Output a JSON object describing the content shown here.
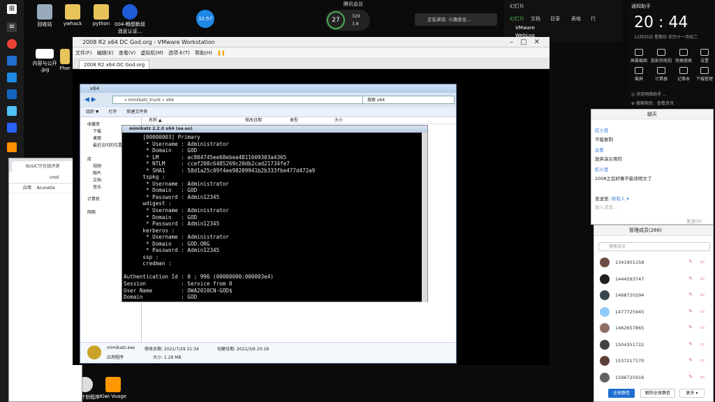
{
  "desktop": {
    "icons": [
      {
        "label": "回收站"
      },
      {
        "label": "ywhack"
      },
      {
        "label": "python"
      },
      {
        "label": "004-畅想新叔 消息认证..."
      },
      {
        "label": "内容与公开 .jpg"
      },
      {
        "label": "Fhor"
      }
    ],
    "bottom_icons": [
      {
        "label": "任务计划程序"
      },
      {
        "label": "Kiwi Vuage"
      }
    ]
  },
  "timer": "32:57",
  "network": {
    "percent": "27",
    "up": "329",
    "down": "3.8"
  },
  "livebar": {
    "label": "腾讯会议"
  },
  "screen_share": {
    "label": "正在讲话: 小逸安全..."
  },
  "ppt": {
    "title": "幻灯片",
    "tabs": [
      "幻灯片",
      "文档",
      "目录",
      "表格",
      "行"
    ],
    "items": [
      "VMware",
      "WebLog"
    ]
  },
  "notification": {
    "header": "通知助手",
    "time": "20 : 44",
    "date": "12月05日 星期日 农历十一月初二",
    "actions": [
      "屏幕截图",
      "投影到电视",
      "快捷搜索",
      "设置",
      "截屏",
      "计算器",
      "记事本",
      "下载管理"
    ],
    "footer": "◎ 浏览网络助手 ...",
    "link": "⊕ 搜索网页，查看资讯"
  },
  "vmware": {
    "title": "2008 R2 x64 DC God.org - VMware Workstation",
    "menu": [
      "文件(F)",
      "编辑(E)",
      "查看(V)",
      "虚拟机(M)",
      "选项卡(T)",
      "帮助(H)"
    ],
    "tab": "2008 R2 x64 DC God.org"
  },
  "explorer": {
    "title": "x64",
    "address": "« mimikatz_trunk » x64",
    "search": "搜索 x64",
    "toolbar": [
      "组织 ▼",
      "打开",
      "新建文件夹"
    ],
    "columns": [
      "名称 ▲",
      "修改日期",
      "类型",
      "大小"
    ],
    "nav": [
      "收藏夹",
      "下载",
      "桌面",
      "最近访问的位置",
      "库",
      "视频",
      "图片",
      "文档",
      "音乐",
      "计算机",
      "网络"
    ],
    "details": {
      "file": "mimikatz.exe",
      "modified": "修改日期: 2021/7/29 21:34",
      "created": "创建日期: 2021/3/9 20:18",
      "type": "应用程序",
      "size": "大小: 1.29 MB"
    }
  },
  "terminal": {
    "title": "mimikatz 2.2.0 x64 (oe.eo)",
    "lines": [
      "      [00000003] Primary",
      "       * Username : Administrator",
      "       * Domain   : GOD",
      "       * LM       : ac804745ee68ebea4811609303a4365",
      "       * NTLM     : ccef208c6485269c20db2cad21734fe7",
      "       * SHA1     : 58d1a25c09f4ee98209941b2b333fbe477d472a9",
      "      tspkg :",
      "       * Username : Administrator",
      "       * Domain   : GOD",
      "       * Password : Admin12345",
      "      wdigest :",
      "       * Username : Administrator",
      "       * Domain   : GOD",
      "       * Password : Admin12345",
      "      kerberos :",
      "       * Username : Administrator",
      "       * Domain   : GOD.ORG",
      "       * Password : Admin12345",
      "      ssp :",
      "      credman :",
      "",
      "Authentication Id : 0 ; 996 (00000000:000003e4)",
      "Session           : Service from 0",
      "User Name         : OWA2010CN-GOD$",
      "Domain            : GOD"
    ]
  },
  "chrome": {
    "tab": "BUUCTF在线评测",
    "url": "cmd",
    "bookmarks": [
      "应用",
      "Acunetix"
    ]
  },
  "chat": {
    "title": "聊天",
    "messages": [
      {
        "name": "紅小豆",
        "text": "不能复制"
      },
      {
        "name": "云笙",
        "text": "放弃演示用的"
      },
      {
        "name": "紅小豆",
        "text": "2008之后好像不能读明文了"
      }
    ],
    "send_to_label": "发送至:",
    "send_to": "所有人 ▾",
    "placeholder": "输入消息...",
    "send_button": "发送(S)"
  },
  "members": {
    "title": "管理成员(266)",
    "search_placeholder": "搜索成员",
    "list": [
      "1341901158",
      "1444593747",
      "1468720294",
      "1477725945",
      "1462657865",
      "1504351722",
      "1537217170",
      "1596725916"
    ],
    "all_mute": "全体静音",
    "unmute_all": "解除全体静音",
    "more": "更多 ▾"
  }
}
